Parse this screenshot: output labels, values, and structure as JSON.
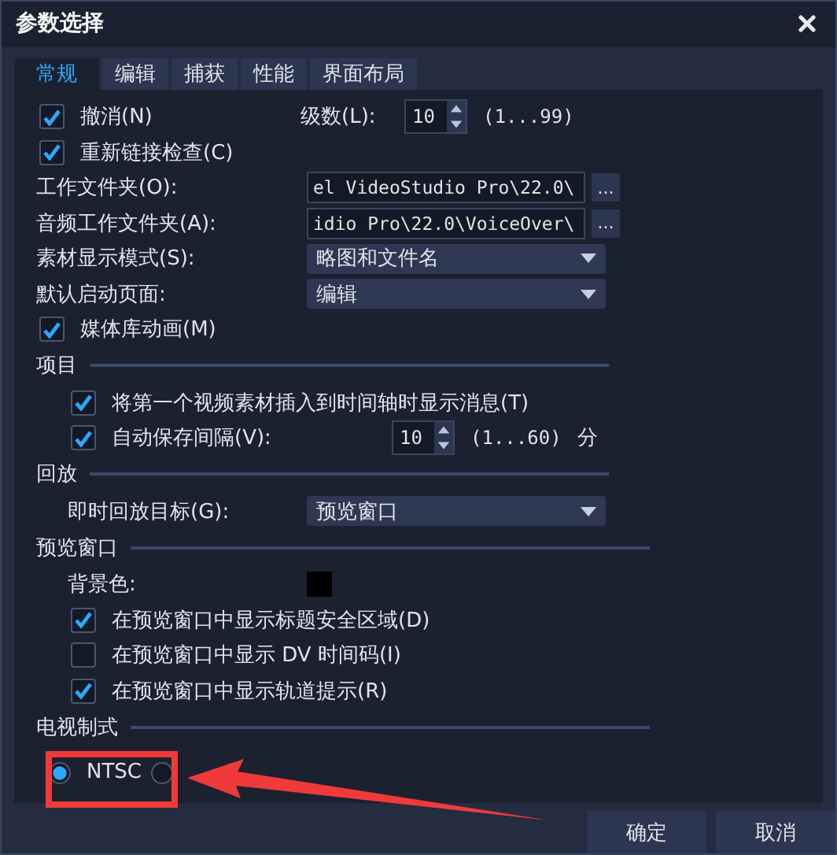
{
  "window": {
    "title": "参数选择"
  },
  "tabs": [
    {
      "label": "常规",
      "selected": true
    },
    {
      "label": "编辑",
      "selected": false
    },
    {
      "label": "捕获",
      "selected": false
    },
    {
      "label": "性能",
      "selected": false
    },
    {
      "label": "界面布局",
      "selected": false
    }
  ],
  "rows": [
    {
      "kind": "check_spin",
      "label": "撤消(N)",
      "checked": true,
      "spin_label": "级数(L):",
      "value": "10",
      "range": "(1...99)"
    },
    {
      "kind": "check",
      "label": "重新链接检查(C)",
      "checked": true
    },
    {
      "kind": "path",
      "label": "工作文件夹(O):",
      "value": "el VideoStudio Pro\\22.0\\",
      "button": "..."
    },
    {
      "kind": "path",
      "label": "音频工作文件夹(A):",
      "value": "idio Pro\\22.0\\VoiceOver\\",
      "button": "..."
    },
    {
      "kind": "dropdown",
      "label": "素材显示模式(S):",
      "value": "略图和文件名"
    },
    {
      "kind": "dropdown",
      "label": "默认启动页面:",
      "value": "编辑"
    },
    {
      "kind": "check",
      "label": "媒体库动画(M)",
      "checked": true
    }
  ],
  "groups": [
    {
      "title": "项目",
      "rows": [
        {
          "kind": "check",
          "label": "将第一个视频素材插入到时间轴时显示消息(T)",
          "checked": true
        },
        {
          "kind": "check_spin",
          "label": "自动保存间隔(V):",
          "checked": true,
          "value": "10",
          "range": "(1...60)",
          "unit": "分"
        }
      ]
    },
    {
      "title": "回放",
      "rows": [
        {
          "kind": "dropdown",
          "label": "即时回放目标(G):",
          "value": "预览窗口"
        }
      ]
    },
    {
      "title": "预览窗口",
      "rows": [
        {
          "kind": "color",
          "label": "背景色:",
          "color": "#000000"
        },
        {
          "kind": "check",
          "label": "在预览窗口中显示标题安全区域(D)",
          "checked": true
        },
        {
          "kind": "check",
          "label": "在预览窗口中显示 DV 时间码(I)",
          "checked": false
        },
        {
          "kind": "check",
          "label": "在预览窗口中显示轨道提示(R)",
          "checked": true
        }
      ]
    },
    {
      "title": "电视制式",
      "rows": [
        {
          "kind": "radios",
          "options": [
            {
              "label": "NTSC",
              "selected": true
            },
            {
              "selected": false
            }
          ]
        }
      ]
    }
  ],
  "buttons": [
    "确定",
    "取消"
  ]
}
